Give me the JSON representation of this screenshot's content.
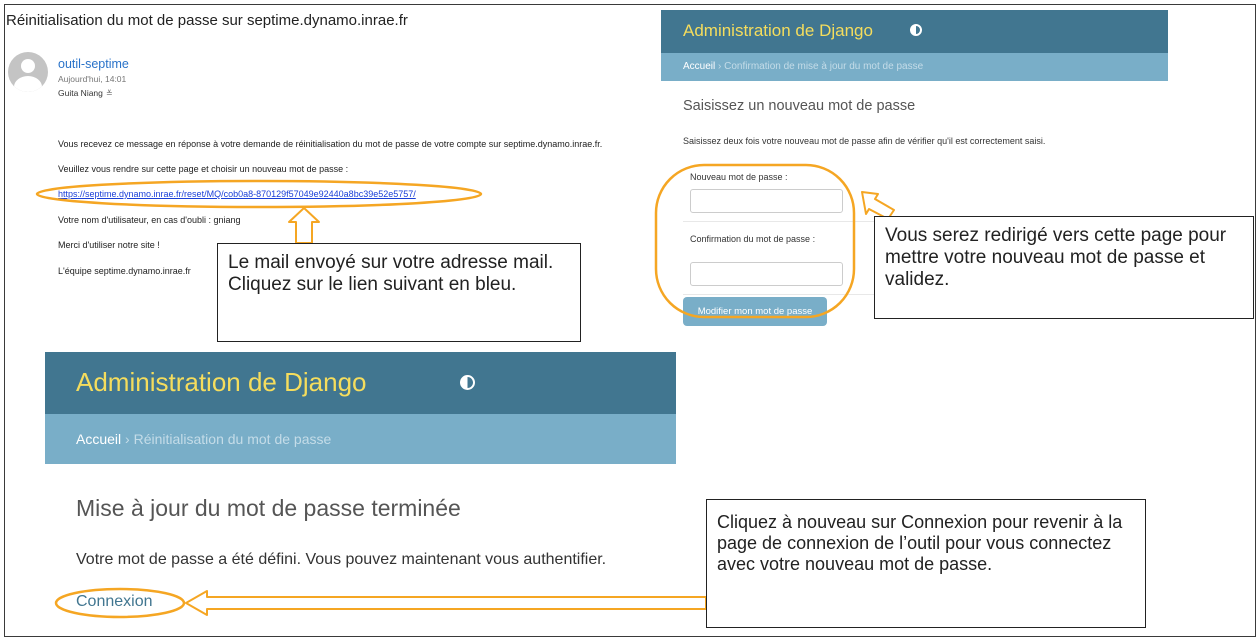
{
  "email": {
    "subject": "Réinitialisation du mot de passe sur septime.dynamo.inrae.fr",
    "sender": "outil-septime",
    "date": "Aujourd'hui, 14:01",
    "recipient": "Guita Niang",
    "body": {
      "line1": "Vous recevez ce message en réponse à votre demande de réinitialisation du mot de passe de votre compte sur septime.dynamo.inrae.fr.",
      "line2": "Veuillez vous rendre sur cette page et choisir un nouveau mot de passe :",
      "link": "https://septime.dynamo.inrae.fr/reset/MQ/cob0a8-870129f57049e92440a8bc39e52e5757/",
      "line4": "Votre nom d'utilisateur, en cas d'oubli : gniang",
      "line5": "Merci d'utiliser notre site !",
      "line6": "L'équipe septime.dynamo.inrae.fr"
    }
  },
  "django_confirm": {
    "title": "Administration de Django",
    "breadcrumb_home": "Accueil",
    "breadcrumb_current": "Confirmation de mise à jour du mot de passe",
    "heading": "Saisissez un nouveau mot de passe",
    "description": "Saisissez deux fois votre nouveau mot de passe afin de vérifier qu'il est correctement saisi.",
    "field1_label": "Nouveau mot de passe :",
    "field2_label": "Confirmation du mot de passe :",
    "submit_label": "Modifier mon mot de passe"
  },
  "django_done": {
    "title": "Administration de Django",
    "breadcrumb_home": "Accueil",
    "breadcrumb_current": "Réinitialisation du mot de passe",
    "heading": "Mise à jour du mot de passe terminée",
    "description": "Votre mot de passe a été défini. Vous pouvez maintenant vous authentifier.",
    "login_link": "Connexion"
  },
  "callouts": {
    "mail": "Le mail envoyé sur votre adresse mail. Cliquez sur le lien suivant en bleu.",
    "redirect": "Vous serez redirigé vers cette page pour mettre votre nouveau mot de passe et validez.",
    "connexion": "Cliquez à nouveau sur Connexion pour revenir à la page de connexion de l’outil pour vous connectez avec votre nouveau mot de passe."
  },
  "colors": {
    "django_header": "#417690",
    "django_breadcrumb": "#79aec8",
    "django_title": "#f5dd5d",
    "annotation_orange": "#f5a623",
    "link_blue": "#1a3fd8"
  },
  "icons": {
    "avatar": "user-avatar-icon",
    "theme_toggle": "half-circle-icon",
    "recipient_expand": "chevron-down-double-icon"
  }
}
